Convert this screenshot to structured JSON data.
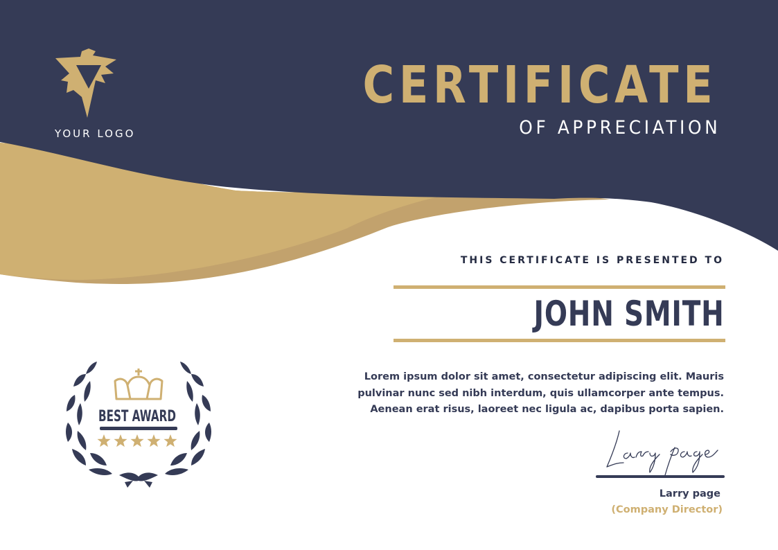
{
  "logo": {
    "text": "YOUR LOGO",
    "icon": "bird-logo-icon"
  },
  "certificate": {
    "title": "CERTIFICATE",
    "subtitle": "OF APPRECIATION",
    "presented_to": "THIS CERTIFICATE IS PRESENTED TO",
    "recipient": "JOHN SMITH",
    "body": "Lorem ipsum dolor sit amet, consectetur adipiscing elit. Mauris pulvinar nunc sed nibh interdum, quis ullamcorper ante tempus. Aenean erat risus, laoreet nec ligula ac, dapibus porta sapien."
  },
  "signature": {
    "script": "Larry page",
    "name": "Larry page",
    "role": "(Company Director)"
  },
  "badge": {
    "label": "BEST AWARD",
    "stars": 5,
    "icons": [
      "laurel-wreath-icon",
      "crown-icon",
      "star-icon"
    ]
  },
  "colors": {
    "navy": "#353b56",
    "gold": "#cfb072",
    "gold_dark": "#c2a26d",
    "text_dark": "#252b42",
    "white": "#ffffff"
  }
}
